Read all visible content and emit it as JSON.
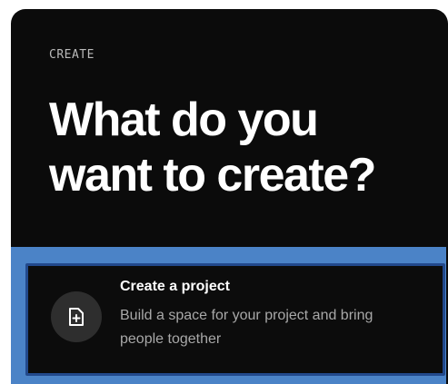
{
  "header": {
    "eyebrow": "CREATE",
    "headline": "What do you want to create?"
  },
  "options": [
    {
      "title": "Create a project",
      "description": "Build a space for your project and bring people together",
      "icon": "new-document-icon"
    }
  ],
  "colors": {
    "background": "#0b0b0b",
    "selection_outer": "#4b83c7",
    "selection_inner": "#22498c",
    "icon_circle": "#2e2e2e",
    "text_primary": "#ffffff",
    "text_secondary": "#a8a8a8"
  }
}
